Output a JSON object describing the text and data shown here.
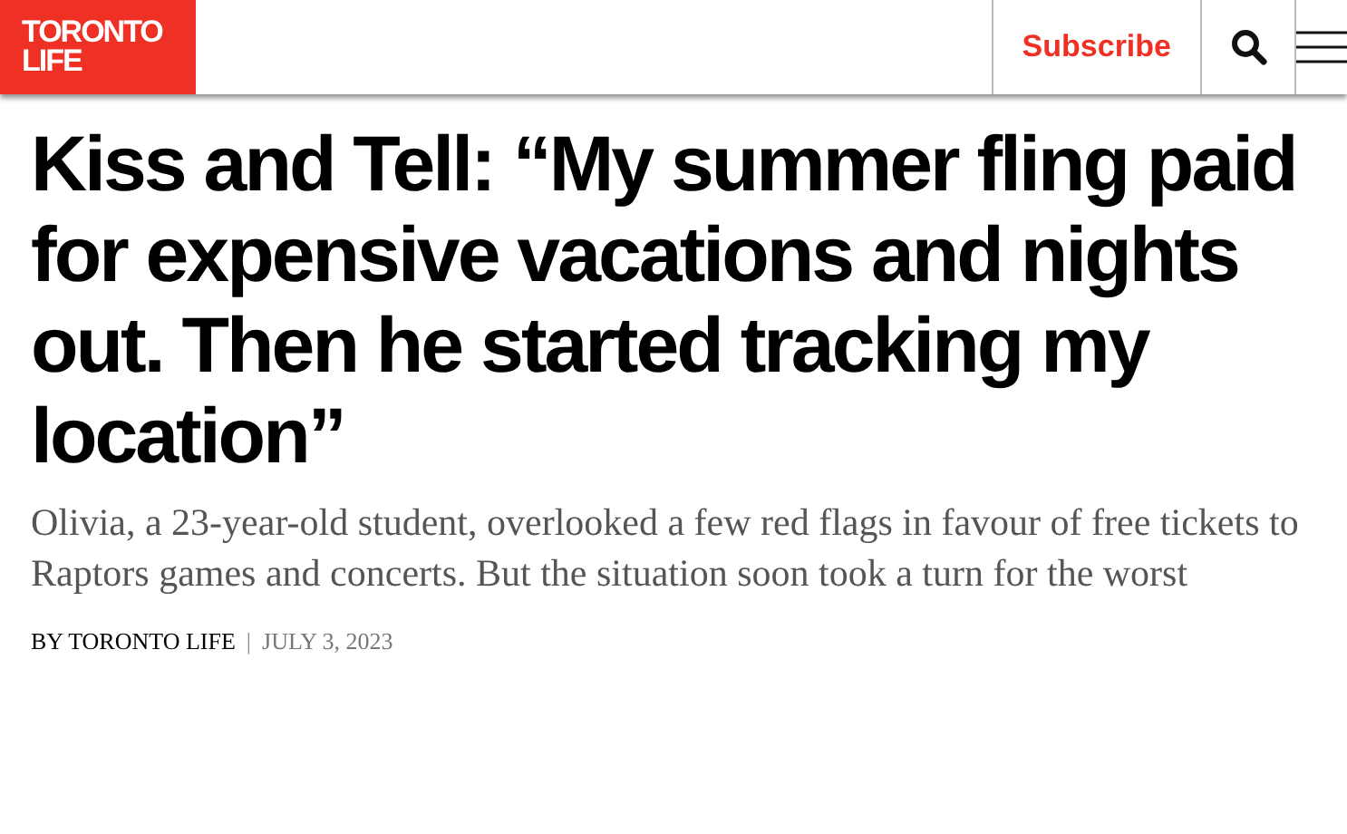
{
  "header": {
    "logo": [
      "TORONTO",
      "LIFE"
    ],
    "subscribe": "Subscribe"
  },
  "article": {
    "headline": "Kiss and Tell: “My summer fling paid for expensive vacations and nights out. Then he started tracking my location”",
    "dek": "Olivia, a 23-year-old student, overlooked a few red flags in favour of free tickets to Raptors games and concerts. But the situation soon took a turn for the worst",
    "byline": "BY TORONTO LIFE",
    "separator": "|",
    "date": "JULY 3, 2023"
  }
}
